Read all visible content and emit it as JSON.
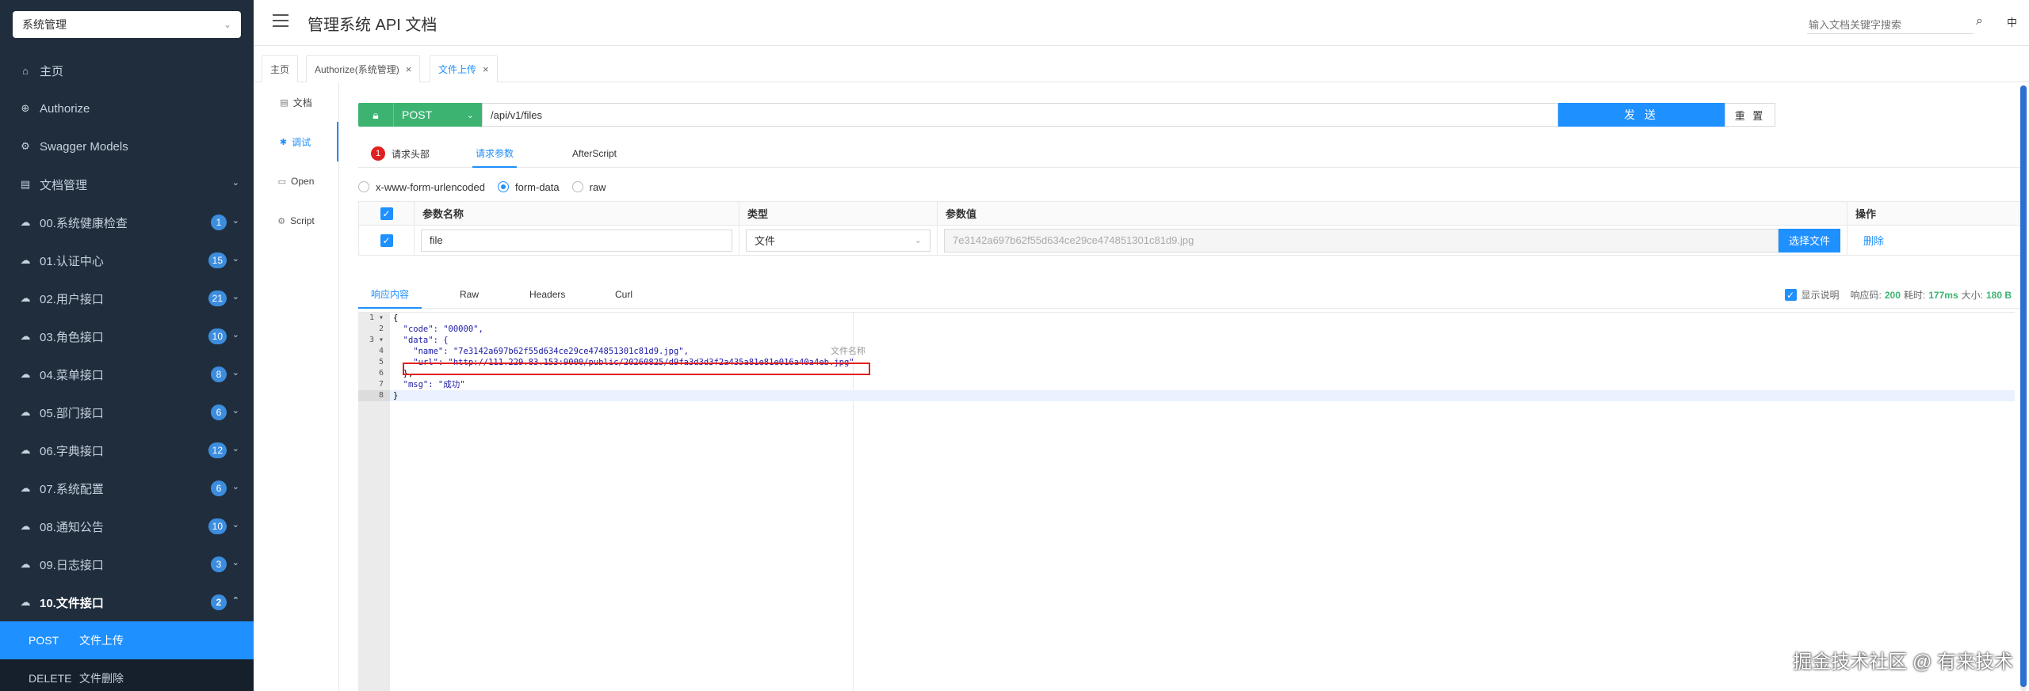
{
  "sidebar": {
    "group_select": "系统管理",
    "items": [
      {
        "label": "主页",
        "icon": "home-icon"
      },
      {
        "label": "Authorize",
        "icon": "lock-icon"
      },
      {
        "label": "Swagger Models",
        "icon": "gear-icon"
      },
      {
        "label": "文档管理",
        "icon": "doc-icon"
      },
      {
        "label": "00.系统健康检查",
        "icon": "cloud-icon",
        "badge": "1"
      },
      {
        "label": "01.认证中心",
        "icon": "cloud-icon",
        "badge": "15"
      },
      {
        "label": "02.用户接口",
        "icon": "cloud-icon",
        "badge": "21"
      },
      {
        "label": "03.角色接口",
        "icon": "cloud-icon",
        "badge": "10"
      },
      {
        "label": "04.菜单接口",
        "icon": "cloud-icon",
        "badge": "8"
      },
      {
        "label": "05.部门接口",
        "icon": "cloud-icon",
        "badge": "6"
      },
      {
        "label": "06.字典接口",
        "icon": "cloud-icon",
        "badge": "12"
      },
      {
        "label": "07.系统配置",
        "icon": "cloud-icon",
        "badge": "6"
      },
      {
        "label": "08.通知公告",
        "icon": "cloud-icon",
        "badge": "10"
      },
      {
        "label": "09.日志接口",
        "icon": "cloud-icon",
        "badge": "3"
      },
      {
        "label": "10.文件接口",
        "icon": "cloud-icon",
        "badge": "2"
      }
    ],
    "sub_items": [
      {
        "method": "POST",
        "label": "文件上传"
      },
      {
        "method": "DELETE",
        "label": "文件删除"
      }
    ]
  },
  "header": {
    "title": "管理系统 API 文档",
    "search_placeholder": "输入文档关键字搜索",
    "lang": "中"
  },
  "tabs": [
    {
      "label": "主页"
    },
    {
      "label": "Authorize(系统管理)",
      "close": "×"
    },
    {
      "label": "文件上传",
      "close": "×"
    }
  ],
  "subnav": [
    {
      "label": "文档"
    },
    {
      "label": "调试"
    },
    {
      "label": "Open"
    },
    {
      "label": "Script"
    }
  ],
  "request": {
    "method": "POST",
    "url": "/api/v1/files",
    "send": "发 送",
    "reset": "重 置",
    "tabs": {
      "headers_count": "1",
      "headers": "请求头部",
      "params": "请求参数",
      "after": "AfterScript"
    },
    "body_types": [
      "x-www-form-urlencoded",
      "form-data",
      "raw"
    ],
    "table": {
      "headers": [
        "参数名称",
        "类型",
        "参数值",
        "操作"
      ],
      "row": {
        "name": "file",
        "type": "文件",
        "value": "7e3142a697b62f55d634ce29ce474851301c81d9.jpg",
        "choose": "选择文件",
        "delete": "删除"
      }
    }
  },
  "response": {
    "tabs": [
      "响应内容",
      "Raw",
      "Headers",
      "Curl"
    ],
    "show_desc": "显示说明",
    "code_label": "响应码:",
    "code": "200",
    "time_label": "耗时:",
    "time": "177ms",
    "size_label": "大小:",
    "size": "180 B",
    "hint": "文件名称",
    "lines": [
      "{",
      "  \"code\": \"00000\",",
      "  \"data\": {",
      "    \"name\": \"7e3142a697b62f55d634ce29ce474851301c81d9.jpg\",",
      "    \"url\": \"http://111.229.83.153:9000/public/20260825/d9fa3d3d3f2a435a81e81e016a40a4eb.jpg\"",
      "  },",
      "  \"msg\": \"成功\"",
      "}"
    ]
  },
  "watermark": "掘金技术社区 @ 有来技术"
}
